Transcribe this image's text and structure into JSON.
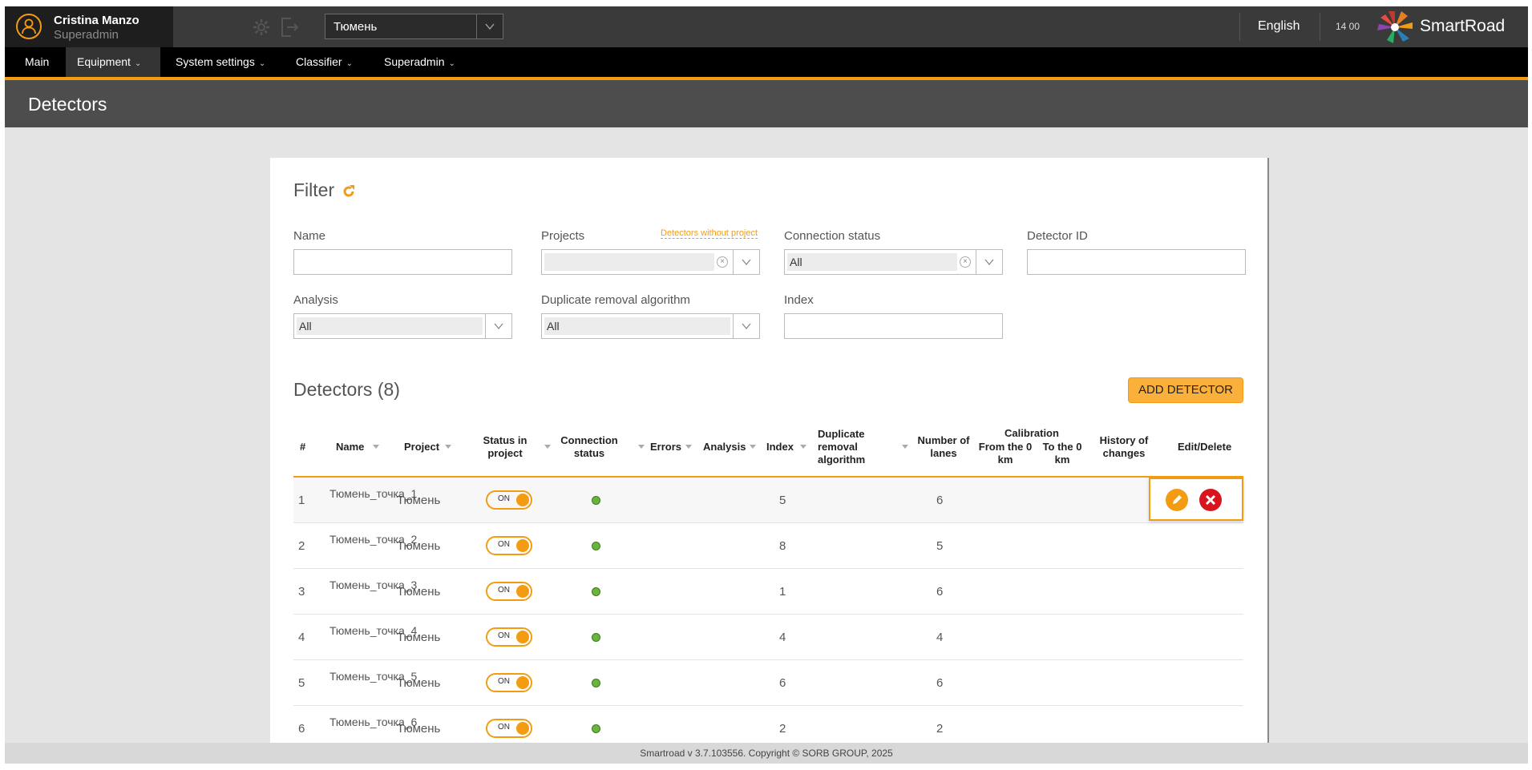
{
  "user": {
    "name": "Cristina Manzo",
    "role": "Superadmin"
  },
  "city_select": {
    "value": "Тюмень"
  },
  "language": "English",
  "clock": "14 00",
  "logo_text": "SmartRoad",
  "menu": [
    {
      "label": "Main"
    },
    {
      "label": "Equipment"
    },
    {
      "label": "System settings"
    },
    {
      "label": "Classifier"
    },
    {
      "label": "Superadmin"
    }
  ],
  "page_title": "Detectors",
  "filter": {
    "title": "Filter",
    "name_label": "Name",
    "name_value": "",
    "projects_label": "Projects",
    "projects_value": "",
    "no_project_link": "Detectors without project",
    "connection_label": "Connection status",
    "connection_value": "All",
    "detector_id_label": "Detector ID",
    "detector_id_value": "",
    "analysis_label": "Analysis",
    "analysis_value": "All",
    "dup_label": "Duplicate removal algorithm",
    "dup_value": "All",
    "index_label": "Index",
    "index_value": ""
  },
  "detectors_title": "Detectors (8)",
  "add_button": "ADD DETECTOR",
  "columns": {
    "num": "#",
    "name": "Name",
    "project": "Project",
    "status_in_project": "Status in project",
    "connection_status": "Connection status",
    "errors": "Errors",
    "analysis": "Analysis",
    "index": "Index",
    "duplicate_removal": "Duplicate removal algorithm",
    "number_of_lanes": "Number of lanes",
    "calibration": "Calibration",
    "from_0_km": "From the 0 km",
    "to_0_km": "To the 0 km",
    "history": "History of changes",
    "edit_delete": "Edit/Delete"
  },
  "rows": [
    {
      "num": "1",
      "name": "Тюмень_точка_1",
      "project": "Тюмень",
      "status": "ON",
      "index": "5",
      "lanes": "6"
    },
    {
      "num": "2",
      "name": "Тюмень_точка_2",
      "project": "Тюмень",
      "status": "ON",
      "index": "8",
      "lanes": "5"
    },
    {
      "num": "3",
      "name": "Тюмень_точка_3",
      "project": "Тюмень",
      "status": "ON",
      "index": "1",
      "lanes": "6"
    },
    {
      "num": "4",
      "name": "Тюмень_точка_4",
      "project": "Тюмень",
      "status": "ON",
      "index": "4",
      "lanes": "4"
    },
    {
      "num": "5",
      "name": "Тюмень_точка_5",
      "project": "Тюмень",
      "status": "ON",
      "index": "6",
      "lanes": "6"
    },
    {
      "num": "6",
      "name": "Тюмень_точка_6",
      "project": "Тюмень",
      "status": "ON",
      "index": "2",
      "lanes": "2"
    }
  ],
  "footer": "Smartroad v 3.7.103556. Copyright © SORB GROUP, 2025",
  "colors": {
    "accent": "#f39c12",
    "delete": "#d9141d",
    "online": "#6ab43e"
  },
  "icons": [
    "user-icon",
    "gear-icon",
    "logout-icon",
    "refresh-icon",
    "edit-icon",
    "delete-icon",
    "chevron-down-icon"
  ]
}
